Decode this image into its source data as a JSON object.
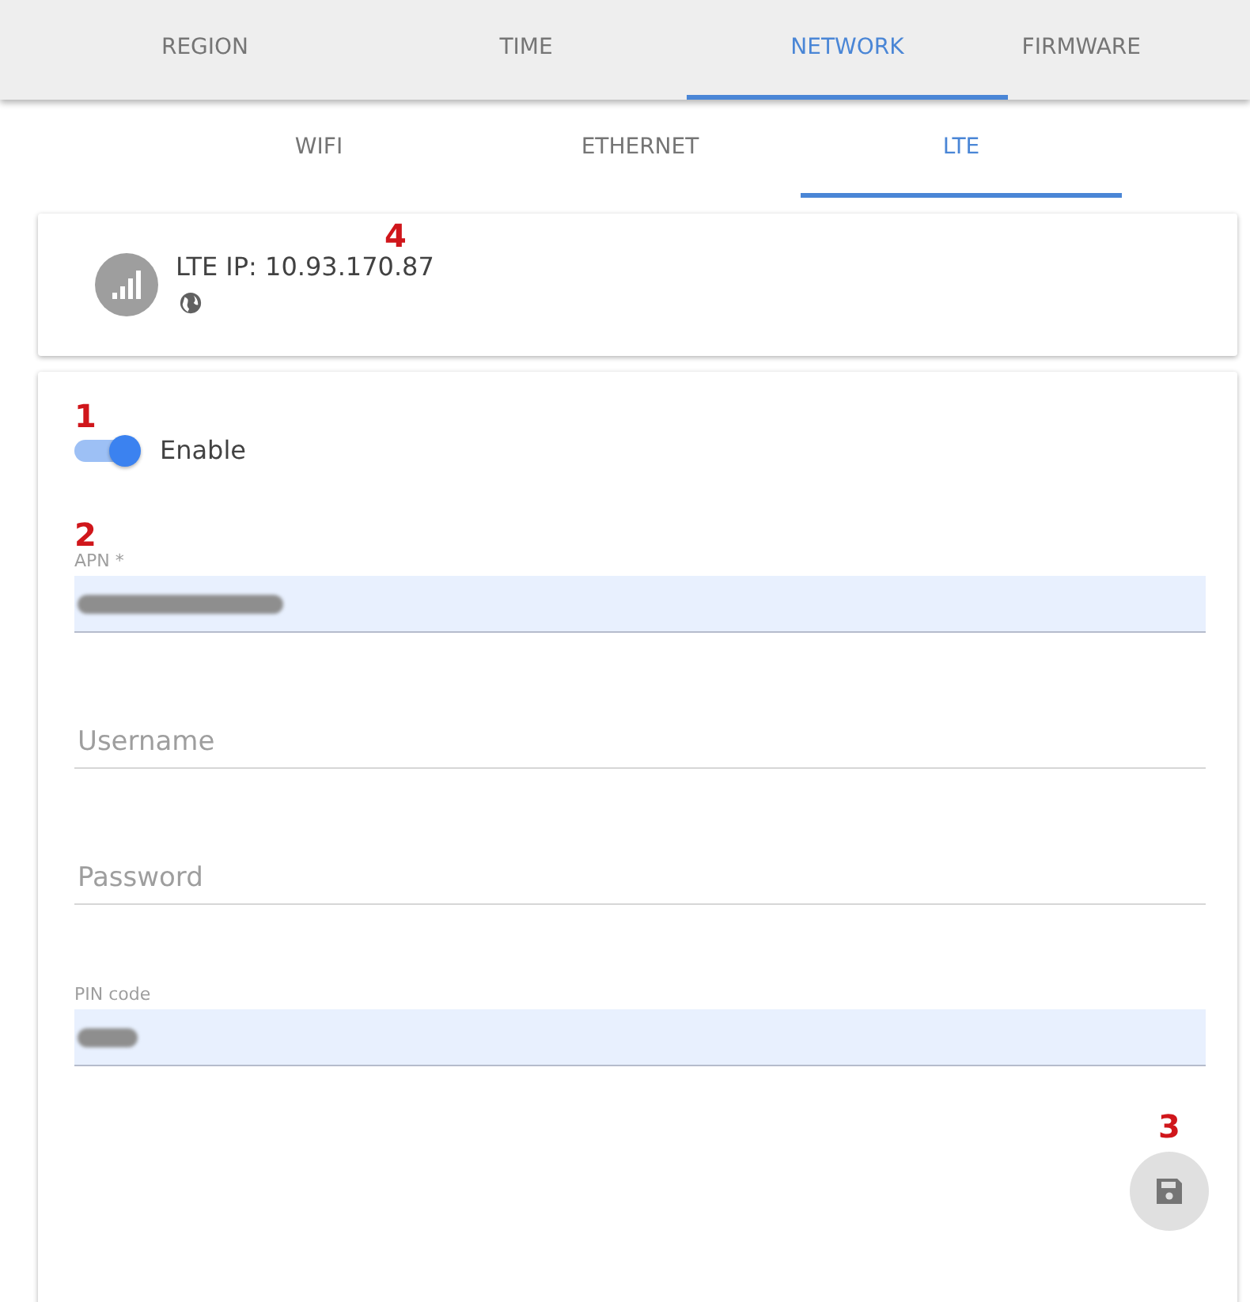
{
  "tabs": [
    {
      "label": "REGION",
      "selected": false
    },
    {
      "label": "TIME",
      "selected": false
    },
    {
      "label": "NETWORK",
      "selected": true
    },
    {
      "label": "FIRMWARE",
      "selected": false
    }
  ],
  "subtabs": [
    {
      "label": "WIFI",
      "selected": false
    },
    {
      "label": "ETHERNET",
      "selected": false
    },
    {
      "label": "LTE",
      "selected": true
    }
  ],
  "status_card": {
    "annotation": "4",
    "text": "LTE IP: 10.93.170.87"
  },
  "enable_toggle": {
    "annotation": "1",
    "label": "Enable",
    "on": true
  },
  "fields": [
    {
      "annotation": "2",
      "label": "APN *",
      "redacted": true
    },
    {
      "placeholder": "Username",
      "redacted": false
    },
    {
      "placeholder": "Password",
      "redacted": false
    },
    {
      "label": "PIN code",
      "redacted": true
    }
  ],
  "save_button": {
    "annotation": "3"
  }
}
